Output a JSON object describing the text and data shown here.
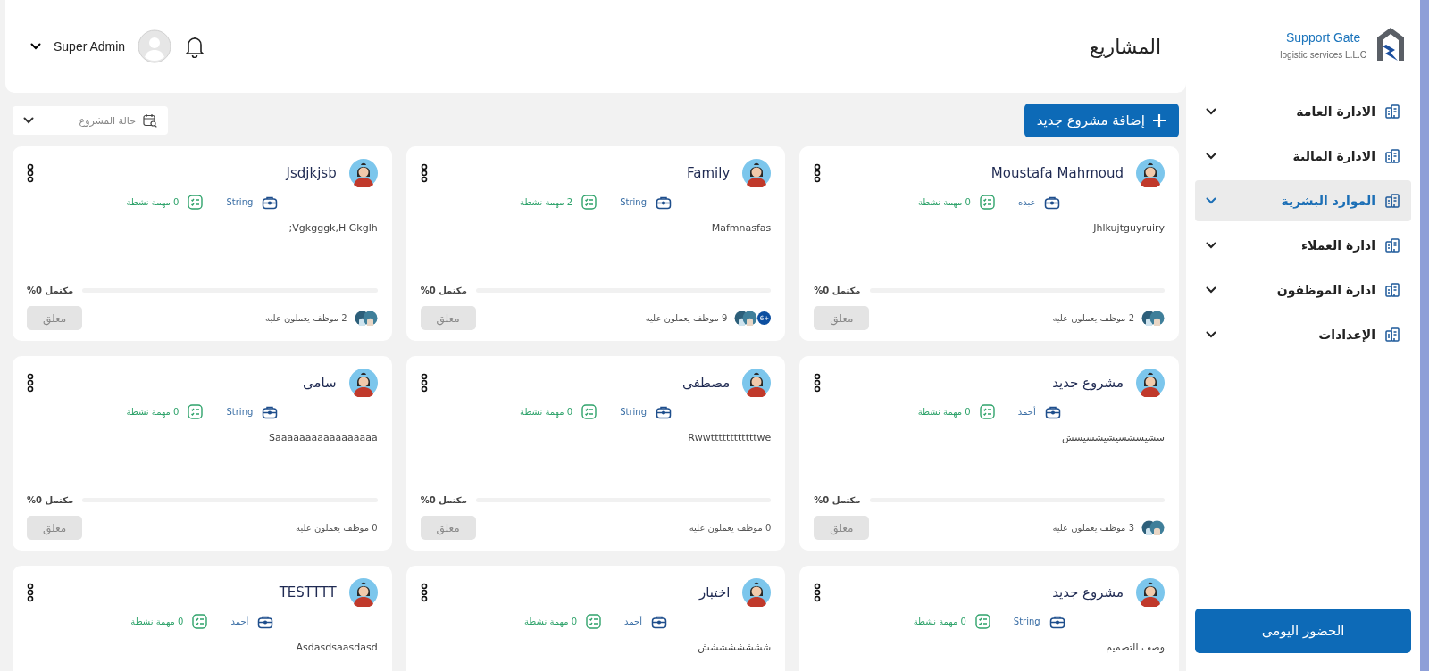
{
  "sidebar": {
    "logo": {
      "title": "Support Gate",
      "subtitle": "logistic services L.L.C"
    },
    "items": [
      {
        "label": "الادارة العامة",
        "selected": false
      },
      {
        "label": "الادارة المالية",
        "selected": false
      },
      {
        "label": "الموارد البشرية",
        "selected": true
      },
      {
        "label": "ادارة العملاء",
        "selected": false
      },
      {
        "label": "ادارة الموظفون",
        "selected": false
      },
      {
        "label": "الإعدادات",
        "selected": false
      }
    ],
    "bottom_button": "الحضور اليومى"
  },
  "header": {
    "title": "المشاريع",
    "user": "Super Admin"
  },
  "toolbar": {
    "add_button": "إضافة مشروع جديد",
    "status_filter": "حالة المشروع"
  },
  "projects": [
    {
      "title": "Moustafa Mahmoud",
      "owner": "عبده",
      "tasks": "0 مهمة نشطة",
      "description": "Jhlkujtguyruiry",
      "progress": {
        "level": 0,
        "label": "%0 مكتمل"
      },
      "members": "2 موظف يعملون عليه",
      "member_avatars": true,
      "status": "معلق"
    },
    {
      "title": "Family",
      "owner": "String",
      "tasks": "2 مهمة نشطة",
      "description": "Mafmnasfas",
      "progress": {
        "level": 0,
        "label": "%0 مكتمل"
      },
      "members": "9 موظف يعملون عليه",
      "member_avatars": true,
      "member_badge": "6+",
      "status": "معلق"
    },
    {
      "title": "Jsdjkjsb",
      "owner": "String",
      "tasks": "0 مهمة نشطة",
      "description": "Vgkgggk,H Gkglh;",
      "progress": {
        "level": 0,
        "label": "%0 مكتمل"
      },
      "members": "2 موظف يعملون عليه",
      "member_avatars": true,
      "status": "معلق"
    },
    {
      "title": "مشروع جديد",
      "owner": "أحمد",
      "tasks": "0 مهمة نشطة",
      "description": "سشيسشسيشيشسيسش",
      "progress": {
        "level": 0,
        "label": "%0 مكتمل"
      },
      "members": "3 موظف يعملون عليه",
      "member_avatars": true,
      "status": "معلق"
    },
    {
      "title": "مصطفى",
      "owner": "String",
      "tasks": "0 مهمة نشطة",
      "description": "Rwwttttttttttttwe",
      "progress": {
        "level": 0,
        "label": "%0 مكتمل"
      },
      "members": "0 موظف يعملون عليه",
      "member_avatars": false,
      "status": "معلق"
    },
    {
      "title": "سامى",
      "owner": "String",
      "tasks": "0 مهمة نشطة",
      "description": "Saaaaaaaaaaaaaaaaa",
      "progress": {
        "level": 0,
        "label": "%0 مكتمل"
      },
      "members": "0 موظف يعملون عليه",
      "member_avatars": false,
      "status": "معلق"
    },
    {
      "title": "مشروع جديد",
      "owner": "String",
      "tasks": "0 مهمة نشطة",
      "description": "وصف التصميم"
    },
    {
      "title": "اختبار",
      "owner": "أحمد",
      "tasks": "0 مهمة نشطة",
      "description": "شششششششش"
    },
    {
      "title": "TESTTTT",
      "owner": "أحمد",
      "tasks": "0 مهمة نشطة",
      "description": "Asdasdsaasdasd"
    }
  ]
}
